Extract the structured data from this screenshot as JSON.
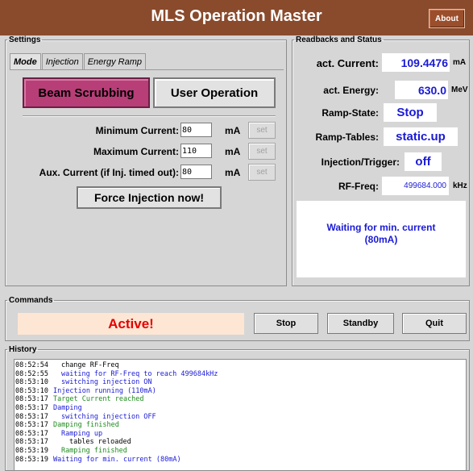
{
  "window": {
    "title": "MLS Operation Master",
    "about_label": "About"
  },
  "settings": {
    "legend": "Settings",
    "tabs": [
      {
        "label": "Mode",
        "active": true
      },
      {
        "label": "Injection",
        "active": false
      },
      {
        "label": "Energy Ramp",
        "active": false
      }
    ],
    "mode_buttons": {
      "beam_scrubbing": "Beam Scrubbing",
      "user_operation": "User Operation",
      "selected": "beam_scrubbing"
    },
    "params": [
      {
        "label": "Minimum Current:",
        "value": "80",
        "unit": "mA",
        "set_label": "set"
      },
      {
        "label": "Maximum Current:",
        "value": "110",
        "unit": "mA",
        "set_label": "set"
      },
      {
        "label": "Aux. Current (if Inj. timed out):",
        "value": "80",
        "unit": "mA",
        "set_label": "set"
      }
    ],
    "force_injection_label": "Force Injection now!"
  },
  "readbacks": {
    "legend": "Readbacks and Status",
    "current": {
      "label": "act. Current:",
      "value": "109.4476",
      "unit": "mA"
    },
    "energy": {
      "label": "act. Energy:",
      "value": "630.0",
      "unit": "MeV"
    },
    "ramp_state": {
      "label": "Ramp-State:",
      "value": "Stop"
    },
    "ramp_tables": {
      "label": "Ramp-Tables:",
      "value": "static.up"
    },
    "injection": {
      "label": "Injection/Trigger:",
      "value": "off"
    },
    "rf_freq": {
      "label": "RF-Freq:",
      "value": "499684.000",
      "unit": "kHz"
    },
    "status_message_line1": "Waiting for min. current",
    "status_message_line2": "(80mA)"
  },
  "commands": {
    "legend": "Commands",
    "state": "Active!",
    "stop_label": "Stop",
    "standby_label": "Standby",
    "quit_label": "Quit"
  },
  "history": {
    "legend": "History",
    "colors": {
      "black": "#000000",
      "blue": "#1a1ad6",
      "green": "#1e8c1e"
    },
    "entries": [
      {
        "time": "08:52:54",
        "indent": 1,
        "message": "change RF-Freq",
        "color": "#000000"
      },
      {
        "time": "08:52:55",
        "indent": 1,
        "message": "waiting for RF-Freq to reach 499684kHz",
        "color": "#1a1ad6"
      },
      {
        "time": "08:53:10",
        "indent": 1,
        "message": "switching injection ON",
        "color": "#1a1ad6"
      },
      {
        "time": "08:53:10",
        "indent": 0,
        "message": "Injection running (110mA)",
        "color": "#1a1ad6"
      },
      {
        "time": "08:53:17",
        "indent": 0,
        "message": "Target Current reached",
        "color": "#1e8c1e"
      },
      {
        "time": "08:53:17",
        "indent": 0,
        "message": "Damping",
        "color": "#1a1ad6"
      },
      {
        "time": "08:53:17",
        "indent": 1,
        "message": "switching injection OFF",
        "color": "#1a1ad6"
      },
      {
        "time": "08:53:17",
        "indent": 0,
        "message": "Damping finished",
        "color": "#1e8c1e"
      },
      {
        "time": "08:53:17",
        "indent": 1,
        "message": "Ramping up",
        "color": "#1a1ad6"
      },
      {
        "time": "08:53:17",
        "indent": 2,
        "message": "tables reloaded",
        "color": "#000000"
      },
      {
        "time": "08:53:19",
        "indent": 1,
        "message": "Ramping finished",
        "color": "#1e8c1e"
      },
      {
        "time": "08:53:19",
        "indent": 0,
        "message": "Waiting for min. current (80mA)",
        "color": "#1a1ad6"
      }
    ]
  }
}
